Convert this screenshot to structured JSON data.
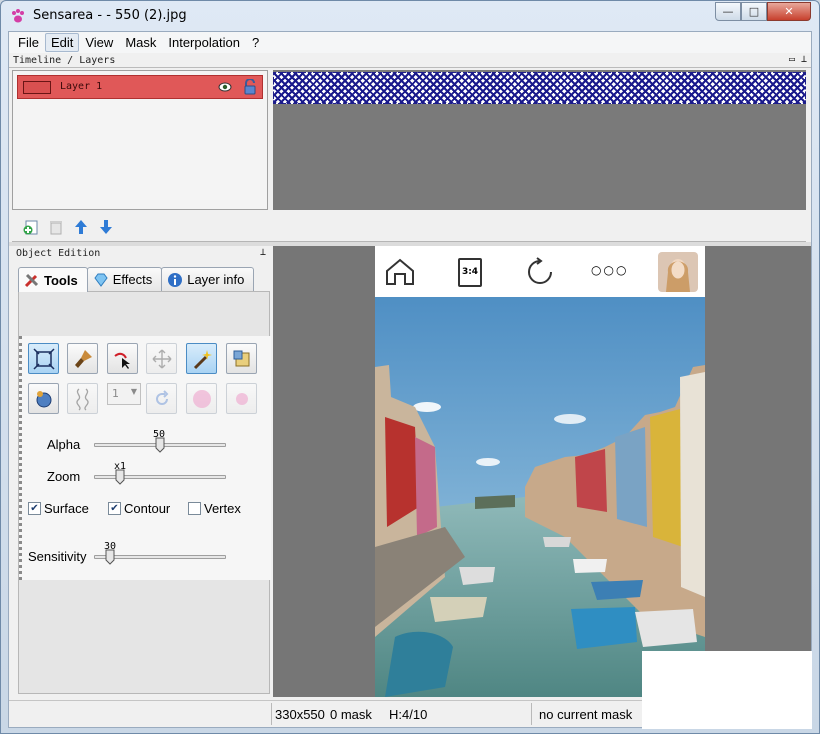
{
  "window": {
    "title": "Sensarea -  - 550 (2).jpg",
    "minimize_label": "—",
    "maximize_label": "□",
    "close_label": "✕"
  },
  "menu": {
    "items": [
      "File",
      "Edit",
      "View",
      "Mask",
      "Interpolation",
      "?"
    ]
  },
  "timeline": {
    "header": "Timeline / Layers",
    "layer_name": "Layer 1"
  },
  "object_edition": {
    "header": "Object Edition",
    "tabs": [
      "Tools",
      "Effects",
      "Layer info"
    ],
    "combo_value": "1",
    "alpha": {
      "label": "Alpha",
      "value": "50",
      "fraction": 0.5
    },
    "zoom": {
      "label": "Zoom",
      "value": "x1",
      "fraction": 0.2
    },
    "checkboxes": [
      {
        "label": "Surface",
        "checked": true
      },
      {
        "label": "Contour",
        "checked": true
      },
      {
        "label": "Vertex",
        "checked": false
      }
    ],
    "sensitivity": {
      "label": "Sensitivity",
      "value": "30",
      "fraction": 0.12
    }
  },
  "phone_bar": {
    "ratio_label": "3:4",
    "more_label": "○○○"
  },
  "status": {
    "size": "330x550",
    "masks": "0 mask",
    "frame": "H:4/10",
    "mask_state": "no current mask"
  },
  "colors": {
    "layer_row": "#e05858",
    "canvas_bg": "#767676",
    "accent": "#4b8cc4"
  }
}
